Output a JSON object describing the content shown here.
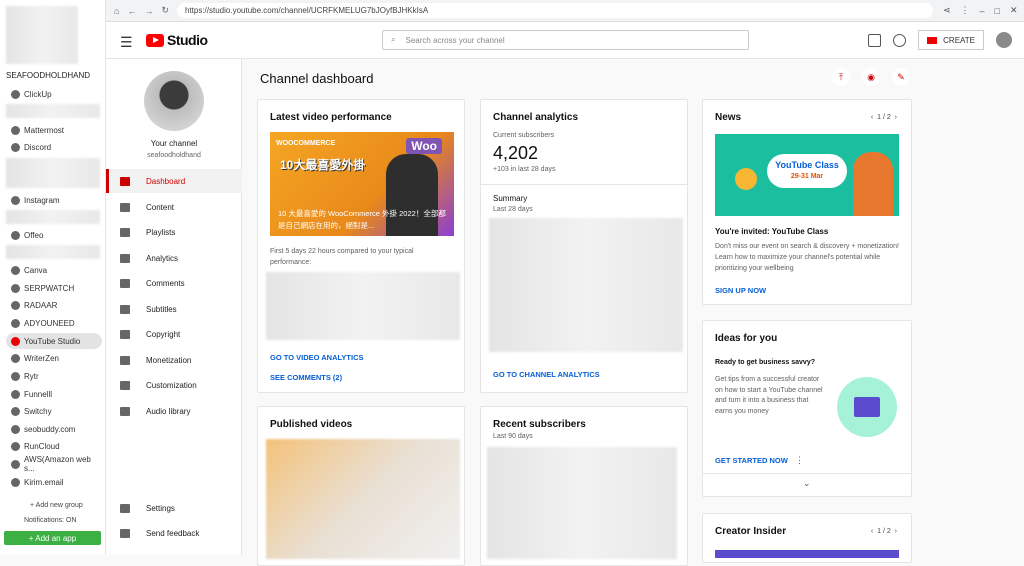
{
  "apps": {
    "workspace_name": "SEAFOODHOLDHAND",
    "items": [
      "ClickUp",
      "Mattermost",
      "Discord",
      "Instagram",
      "Offeo",
      "Canva",
      "SERPWATCH",
      "RADAAR",
      "ADYOUNEED",
      "YouTube Studio",
      "WriterZen",
      "Rytr",
      "Funnelll",
      "Switchy",
      "seobuddy.com",
      "RunCloud",
      "AWS(Amazon web s...",
      "Kirim.email"
    ],
    "add_group": "+ Add new group",
    "notifications": "Notifications: ON",
    "add_app": "+ Add an app"
  },
  "browser": {
    "url": "https://studio.youtube.com/channel/UCRFKMELUG7bJOyfBJHKkIsA"
  },
  "header": {
    "logo_text": "Studio",
    "search_placeholder": "Search across your channel",
    "create_label": "CREATE"
  },
  "nav": {
    "channel_label": "Your channel",
    "channel_handle": "seafoodholdhand",
    "items": [
      "Dashboard",
      "Content",
      "Playlists",
      "Analytics",
      "Comments",
      "Subtitles",
      "Copyright",
      "Monetization",
      "Customization",
      "Audio library"
    ],
    "settings": "Settings",
    "feedback": "Send feedback"
  },
  "main": {
    "title": "Channel dashboard",
    "latest": {
      "title": "Latest video performance",
      "thumb_brand": "WOOCOMMERCE",
      "thumb_woo": "Woo",
      "thumb_big": "10大最喜愛外掛",
      "caption": "10 大最喜愛的 WooCommerce 外掛 2022！全部都是自己網店在用的，絕對是...",
      "compare": "First 5 days 22 hours compared to your typical performance:",
      "link_analytics": "GO TO VIDEO ANALYTICS",
      "link_comments": "SEE COMMENTS (2)"
    },
    "analytics": {
      "title": "Channel analytics",
      "subs_label": "Current subscribers",
      "subs_value": "4,202",
      "subs_delta": "+103 in last 28 days",
      "summary": "Summary",
      "summary_period": "Last 28 days",
      "link": "GO TO CHANNEL ANALYTICS"
    },
    "news": {
      "title": "News",
      "pager": "1 / 2",
      "img_title": "YouTube Class",
      "img_date": "29-31 Mar",
      "headline": "You're invited: YouTube Class",
      "body": "Don't miss our event on search & discovery + monetization! Learn how to maximize your channel's potential while prioritizing your wellbeing",
      "link": "SIGN UP NOW"
    },
    "ideas": {
      "title": "Ideas for you",
      "headline": "Ready to get business savvy?",
      "body": "Get tips from a successful creator on how to start a YouTube channel and turn it into a business that earns you money",
      "link": "GET STARTED NOW"
    },
    "published": {
      "title": "Published videos"
    },
    "recent": {
      "title": "Recent subscribers",
      "period": "Last 90 days"
    },
    "insider": {
      "title": "Creator Insider",
      "pager": "1 / 2"
    }
  }
}
